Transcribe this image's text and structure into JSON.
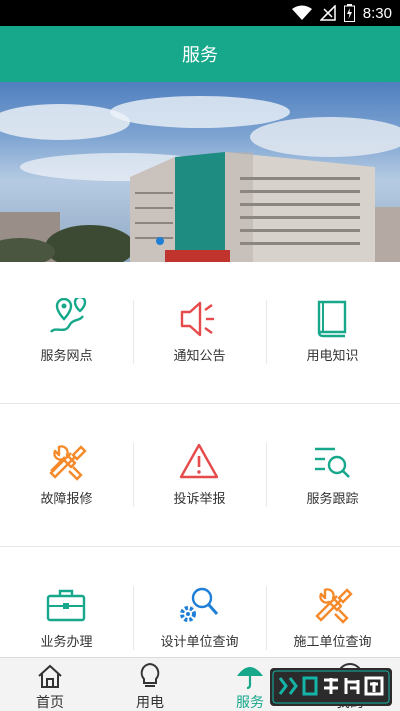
{
  "status_bar": {
    "time": "8:30"
  },
  "app_bar": {
    "title": "服务"
  },
  "banner": {
    "active_slide": 1,
    "total_slides": 1
  },
  "grid": [
    {
      "label": "服务网点",
      "icon": "location-pin-icon",
      "color": "#17a88b"
    },
    {
      "label": "通知公告",
      "icon": "speaker-icon",
      "color": "#e64a4a"
    },
    {
      "label": "用电知识",
      "icon": "book-icon",
      "color": "#17a88b"
    },
    {
      "label": "故障报修",
      "icon": "tools-icon",
      "color": "#f58a2b"
    },
    {
      "label": "投诉举报",
      "icon": "warning-icon",
      "color": "#e64a4a"
    },
    {
      "label": "服务跟踪",
      "icon": "search-list-icon",
      "color": "#17a88b"
    },
    {
      "label": "业务办理",
      "icon": "briefcase-icon",
      "color": "#17a88b"
    },
    {
      "label": "设计单位查询",
      "icon": "gear-search-icon",
      "color": "#1f7fd6"
    },
    {
      "label": "施工单位查询",
      "icon": "tools-icon",
      "color": "#f58a2b"
    }
  ],
  "bottom_nav": [
    {
      "label": "首页",
      "icon": "home-icon",
      "active": false
    },
    {
      "label": "用电",
      "icon": "lightbulb-icon",
      "active": false
    },
    {
      "label": "服务",
      "icon": "umbrella-icon",
      "active": true
    },
    {
      "label": "我的",
      "icon": "user-icon",
      "active": false
    }
  ],
  "watermark": {
    "text": "谷普软件园"
  },
  "colors": {
    "primary": "#17a88b",
    "red": "#e64a4a",
    "orange": "#f58a2b",
    "blue": "#1f7fd6"
  }
}
